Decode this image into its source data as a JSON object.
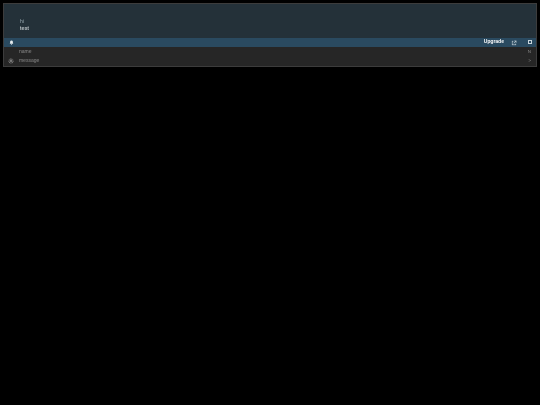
{
  "header": {
    "line1": "hi",
    "line2": "test"
  },
  "toolbar": {
    "upgrade_label": "Upgrade",
    "icons": [
      "bell-icon",
      "external-link-icon",
      "square-icon"
    ]
  },
  "form": {
    "name_placeholder": "name",
    "name_indicator": "N",
    "message_placeholder": "message",
    "message_indicator": ">",
    "icons": [
      "gear-icon"
    ]
  },
  "colors": {
    "background": "#000000",
    "panel": "#262626",
    "header": "#243139",
    "toolbar": "#2a4a60"
  }
}
